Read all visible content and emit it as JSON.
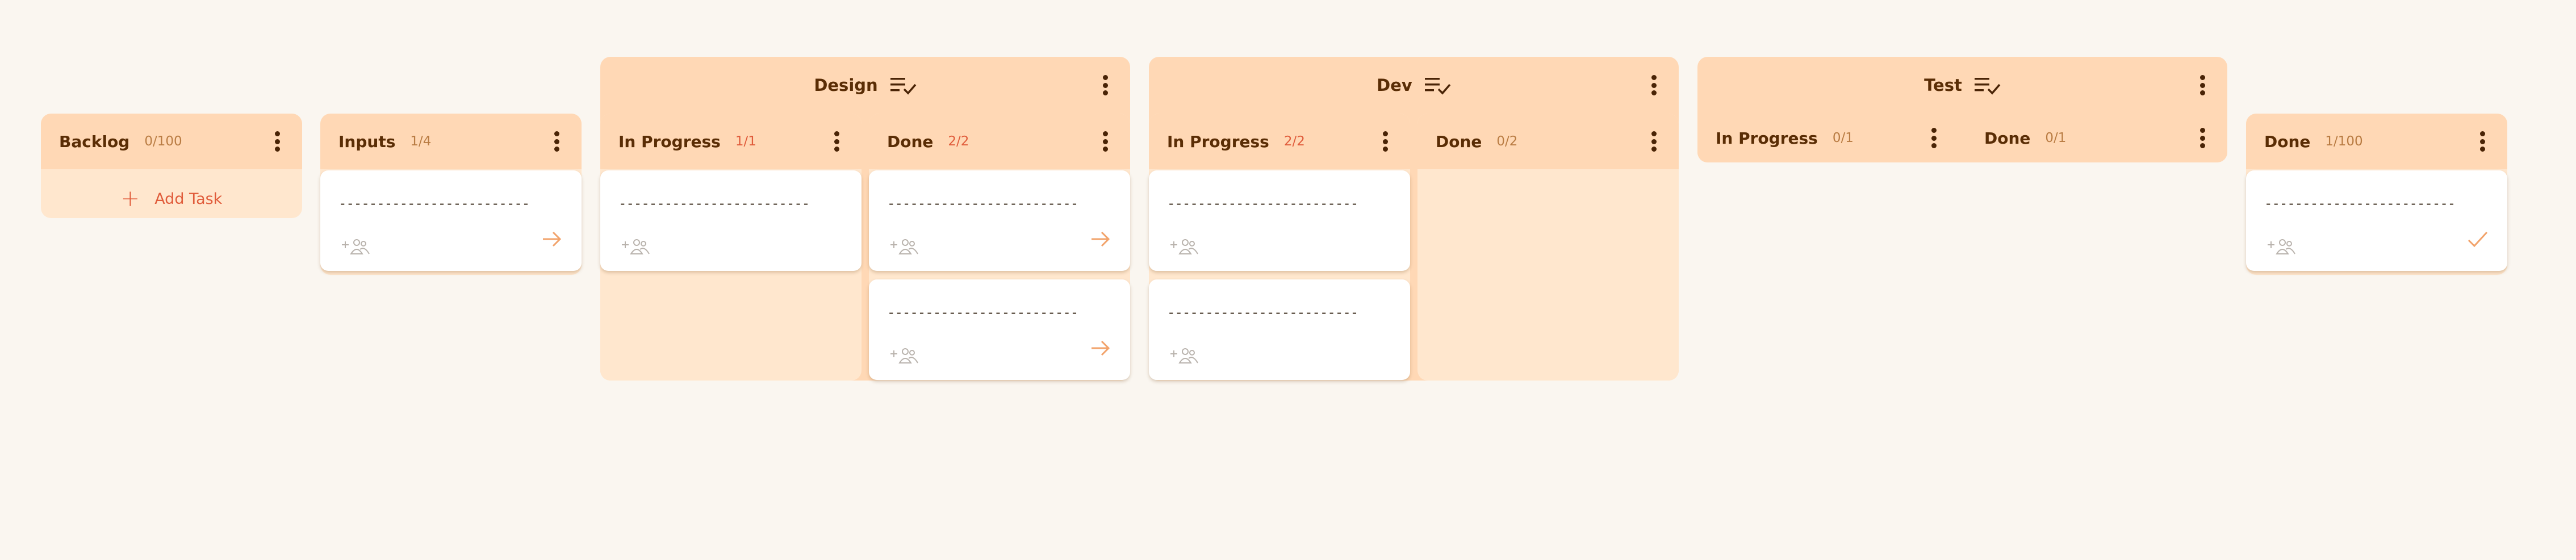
{
  "board": {
    "columns": [
      {
        "name": "Backlog",
        "count": "0/100",
        "add_label": "Add Task"
      },
      {
        "name": "Inputs",
        "count": "1/4"
      },
      {
        "name": "In Progress",
        "count": "1/1"
      },
      {
        "name": "Done",
        "count": "2/2"
      },
      {
        "name": "In Progress",
        "count": "2/2"
      },
      {
        "name": "Done",
        "count": "0/2"
      },
      {
        "name": "In Progress",
        "count": "0/1"
      },
      {
        "name": "Done",
        "count": "0/1"
      },
      {
        "name": "Done",
        "count": "1/100"
      }
    ],
    "groups": [
      {
        "title": "Design",
        "icon": "checklist-icon"
      },
      {
        "title": "Dev",
        "icon": "checklist-icon"
      },
      {
        "title": "Test",
        "icon": "checklist-icon"
      }
    ],
    "card_text": "-------------------------",
    "colors": {
      "background": "#faf6f0",
      "column": "#ffe7ce",
      "header": "#ffd8b5",
      "accent": "#e05c3b",
      "text": "#5a2d05"
    }
  }
}
